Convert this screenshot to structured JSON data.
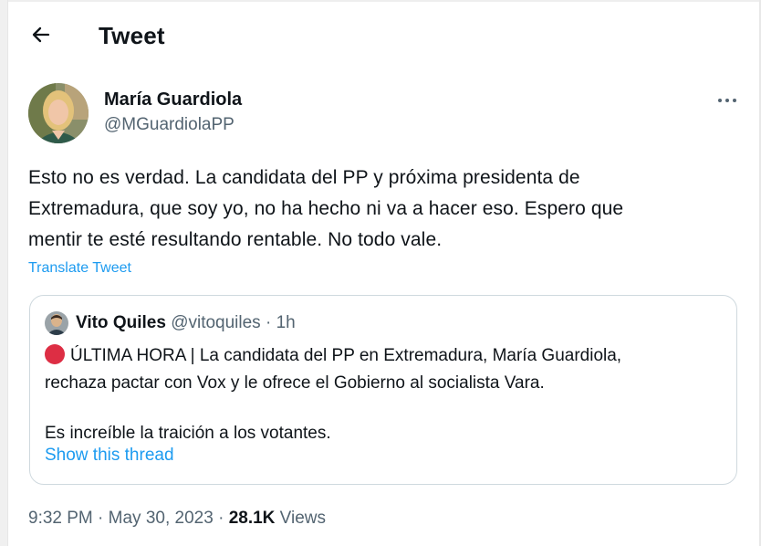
{
  "header": {
    "title": "Tweet"
  },
  "tweet": {
    "author_name": "María Guardiola",
    "author_handle": "@MGuardiolaPP",
    "text_lines": [
      "Esto no es verdad. La candidata del PP y próxima presidenta de",
      "Extremadura, que soy yo, no ha hecho ni va a hacer eso. Espero que",
      "mentir te esté resultando rentable. No todo vale."
    ],
    "translate_label": "Translate Tweet"
  },
  "quote": {
    "author_name": "Vito Quiles",
    "author_handle": "@vitoquiles",
    "separator": "·",
    "time": "1h",
    "lines": [
      "ÚLTIMA HORA | La candidata del PP en Extremadura, María Guardiola,",
      "rechaza pactar con Vox y le ofrece el Gobierno al socialista Vara.",
      "Es increíble la traición a los votantes."
    ],
    "show_thread_label": "Show this thread"
  },
  "meta": {
    "time": "9:32 PM",
    "separator": "·",
    "date": "May 30, 2023",
    "views_count": "28.1K",
    "views_label": "Views"
  },
  "colors": {
    "link": "#1d9bf0",
    "secondary_text": "#536471",
    "alert_red": "#dd2e44"
  }
}
